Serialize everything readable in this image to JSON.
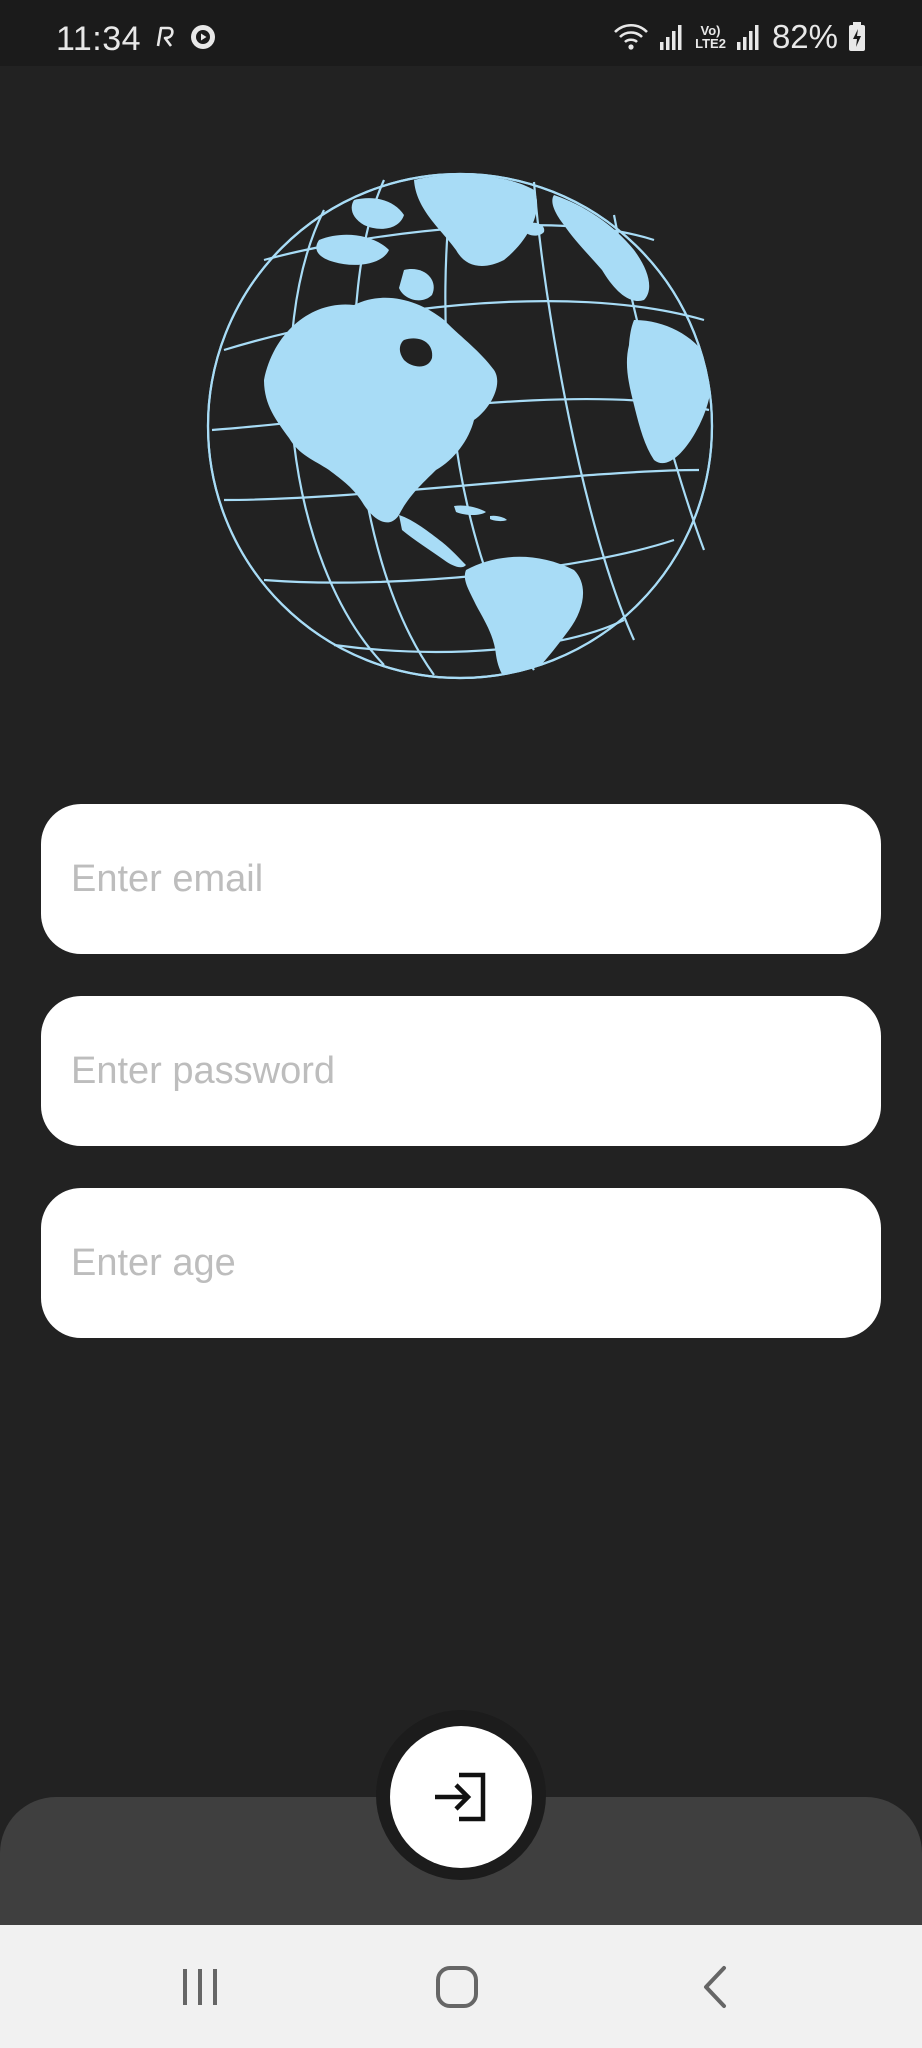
{
  "status_bar": {
    "time": "11:34",
    "battery_percent": "82%",
    "network_label_top": "Vo)",
    "network_label_bottom": "LTE2"
  },
  "form": {
    "email_placeholder": "Enter email",
    "password_placeholder": "Enter password",
    "age_placeholder": "Enter age"
  },
  "icons": {
    "logo": "globe-icon",
    "submit": "login-icon",
    "nav_recents": "recents-icon",
    "nav_home": "home-icon",
    "nav_back": "back-icon"
  },
  "colors": {
    "background": "#222222",
    "globe": "#a8dcf6",
    "field": "#ffffff",
    "placeholder": "#bdbdbd",
    "bottom_panel": "#3f3f3f",
    "navbar": "#f1f1f1"
  }
}
